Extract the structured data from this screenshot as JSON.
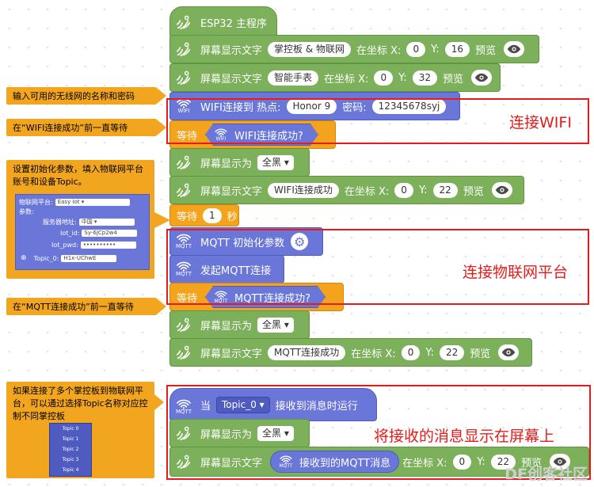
{
  "blocks": {
    "main_hat": "ESP32 主程序",
    "disp_text_1": {
      "label": "屏幕显示文字",
      "text": "掌控板 & 物联网",
      "at": "在坐标 X:",
      "x": "0",
      "ylbl": "Y:",
      "y": "16",
      "preview": "预览"
    },
    "disp_text_2": {
      "label": "屏幕显示文字",
      "text": "智能手表",
      "at": "在坐标 X:",
      "x": "0",
      "ylbl": "Y:",
      "y": "32",
      "preview": "预览"
    },
    "wifi_connect": {
      "label": "WIFI连接到 热点:",
      "ssid": "Honor 9",
      "pwd_label": "密码:",
      "pwd": "12345678syj",
      "icon_text": "WIFI"
    },
    "wait_wifi": {
      "label": "等待",
      "cond": "WIFI连接成功?",
      "icon_text": "WIFI"
    },
    "fill_1": {
      "label": "屏幕显示为",
      "value": "全黑"
    },
    "disp_text_3": {
      "label": "屏幕显示文字",
      "text": "WIFI连接成功",
      "at": "在坐标 X:",
      "x": "0",
      "ylbl": "Y:",
      "y": "22",
      "preview": "预览"
    },
    "wait_1s": {
      "label": "等待",
      "num": "1",
      "unit": "秒"
    },
    "mqtt_init": {
      "label": "MQTT 初始化参数",
      "icon_text": "MQTT"
    },
    "mqtt_connect": {
      "label": "发起MQTT连接",
      "icon_text": "MQTT"
    },
    "wait_mqtt": {
      "label": "等待",
      "cond": "MQTT连接成功?",
      "icon_text": "MQTT"
    },
    "fill_2": {
      "label": "屏幕显示为",
      "value": "全黑"
    },
    "disp_text_4": {
      "label": "屏幕显示文字",
      "text": "MQTT连接成功",
      "at": "在坐标 X:",
      "x": "0",
      "ylbl": "Y:",
      "y": "22",
      "preview": "预览"
    },
    "on_msg": {
      "when": "当",
      "topic": "Topic_0",
      "label": "接收到消息时运行",
      "icon_text": "MQTT"
    },
    "fill_3": {
      "label": "屏幕显示为",
      "value": "全黑"
    },
    "disp_text_5": {
      "label": "屏幕显示文字",
      "text": "接收到的MQTT消息",
      "at": "在坐标 X:",
      "x": "0",
      "ylbl": "Y:",
      "y": "22",
      "preview": "预览",
      "icon_text": "MQTT"
    }
  },
  "annotations": {
    "wifi": "连接WIFI",
    "mqtt": "连接物联网平台",
    "display": "将接收的消息显示在屏幕上"
  },
  "notes": {
    "n1": "输入可用的无线网的名称和密码",
    "n2": "在“WIFI连接成功”前一直等待",
    "n3": "设置初始化参数，填入物联网平台账号和设备Topic。",
    "n4": "在“MQTT连接成功”前一直等待",
    "n5": "如果连接了多个掌控板到物联网平台，可以通过选择Topic名称对应控制不同掌控板"
  },
  "mqtt_form": {
    "platform_label": "物联网平台:",
    "platform": "Easy Iot",
    "params_label": "参数:",
    "server_label": "服务器地址:",
    "server": "中国",
    "iot_id_label": "Iot_id:",
    "iot_id": "Sy-6JCp2w4",
    "iot_pwd_label": "Iot_pwd:",
    "iot_pwd": "••••••••••",
    "topic_label": "Topic_0:",
    "topic": "H1x-UChwE"
  },
  "topic_list": [
    "Topic 0",
    "Topic 1",
    "Topic 2",
    "Topic 3",
    "Topic 4"
  ],
  "watermark": "DF创客社区",
  "colors": {
    "green": "#7db05a",
    "blue": "#6a76d8",
    "orange": "#f4a31c",
    "red": "#e81b1b",
    "note": "#f2a51f"
  }
}
